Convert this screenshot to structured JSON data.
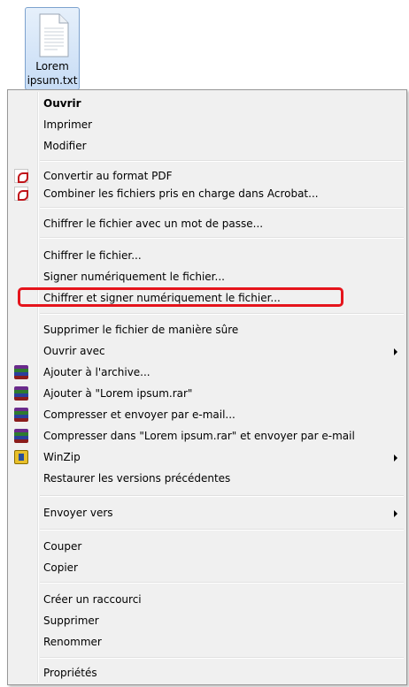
{
  "file": {
    "name_line1": "Lorem",
    "name_line2": "ipsum.txt",
    "icon": "text-file-icon"
  },
  "menu": {
    "items": [
      {
        "label": "Ouvrir"
      },
      {
        "label": "Imprimer"
      },
      {
        "label": "Modifier"
      },
      {
        "label": "Convertir au format PDF",
        "icon": "pdf-icon"
      },
      {
        "label": "Combiner les fichiers pris en charge dans Acrobat...",
        "icon": "pdf-combine-icon"
      },
      {
        "label": "Chiffrer le fichier avec un mot de passe..."
      },
      {
        "label": "Chiffrer le fichier..."
      },
      {
        "label": "Signer numériquement le fichier..."
      },
      {
        "label": "Chiffrer et signer numériquement le fichier..."
      },
      {
        "label": "Supprimer le fichier de manière sûre"
      },
      {
        "label": "Ouvrir avec",
        "submenu": true
      },
      {
        "label": "Ajouter à l'archive...",
        "icon": "winrar-icon"
      },
      {
        "label": "Ajouter à \"Lorem ipsum.rar\"",
        "icon": "winrar-icon"
      },
      {
        "label": "Compresser et envoyer par e-mail...",
        "icon": "winrar-icon"
      },
      {
        "label": "Compresser dans \"Lorem ipsum.rar\" et envoyer par e-mail",
        "icon": "winrar-icon"
      },
      {
        "label": "WinZip",
        "icon": "winzip-icon",
        "submenu": true
      },
      {
        "label": "Restaurer les versions précédentes"
      },
      {
        "label": "Envoyer vers",
        "submenu": true
      },
      {
        "label": "Couper"
      },
      {
        "label": "Copier"
      },
      {
        "label": "Créer un raccourci"
      },
      {
        "label": "Supprimer"
      },
      {
        "label": "Renommer"
      },
      {
        "label": "Propriétés"
      }
    ],
    "highlight_color": "#e5141c"
  }
}
